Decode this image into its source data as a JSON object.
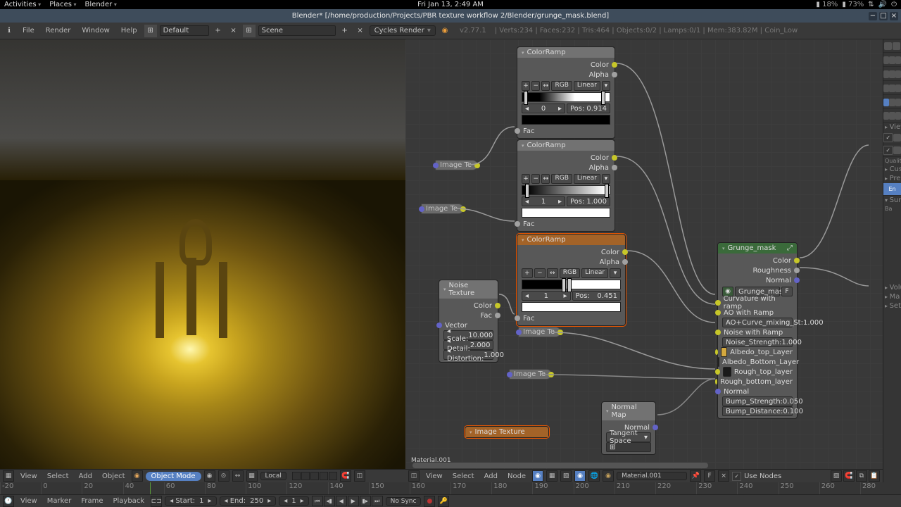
{
  "os_topbar": {
    "activities": "Activities",
    "places": "Places",
    "blender": "Blender",
    "datetime": "Fri Jan 13,  2:49 AM",
    "cpu_pct": "18%",
    "ram_pct": "73%"
  },
  "window_title": "Blender* [/home/production/Projects/PBR texture workflow 2/Blender/grunge_mask.blend]",
  "top_menu": {
    "file": "File",
    "render": "Render",
    "window": "Window",
    "help": "Help",
    "layout": "Default",
    "scene": "Scene",
    "engine": "Cycles Render",
    "version": "v2.77.1",
    "stats": "Verts:234 | Faces:232 | Tris:464 | Objects:0/2 | Lamps:0/1 | Mem:383.82M | Coin_Low"
  },
  "viewport": {
    "menus": {
      "view": "View",
      "select": "Select",
      "add": "Add",
      "object": "Object"
    },
    "mode": "Object Mode",
    "orientation": "Local"
  },
  "node_editor": {
    "menus": {
      "view": "View",
      "select": "Select",
      "add": "Add",
      "node": "Node"
    },
    "material_name": "Material.001",
    "use_nodes_label": "Use Nodes",
    "material_label": "Material.001"
  },
  "nodes": {
    "imgtex_1": "Image Te",
    "imgtex_2": "Image Te",
    "imgtex_3": "Image Te",
    "imgtex_4": "Image Te",
    "noise": {
      "title": "Noise Texture",
      "out_color": "Color",
      "out_fac": "Fac",
      "in_vector": "Vector",
      "scale_l": "Scale:",
      "scale_v": "10.000",
      "detail_l": "Detail:",
      "detail_v": "2.000",
      "distort_l": "Distortion:",
      "distort_v": "1.000"
    },
    "ramp": {
      "title": "ColorRamp",
      "out_color": "Color",
      "out_alpha": "Alpha",
      "in_fac": "Fac",
      "mode": "RGB",
      "interp": "Linear",
      "pos_l": "Pos:"
    },
    "ramp1": {
      "index": "0",
      "pos": "0.914"
    },
    "ramp2": {
      "index": "1",
      "pos": "1.000"
    },
    "ramp3": {
      "index": "1",
      "pos": "0.451"
    },
    "normal_map": {
      "title": "Normal Map",
      "out": "Normal",
      "space": "Tangent Space"
    },
    "image_texture_bottom": {
      "title": "Image Texture"
    },
    "grunge": {
      "title": "Grunge_mask",
      "out_color": "Color",
      "out_roughness": "Roughness",
      "out_normal": "Normal",
      "group_name": "Grunge_mask",
      "f_label": "F",
      "curv": "Curvature with ramp",
      "ao": "AO with Ramp",
      "ao_curve_l": "AO+Curve_mixing_St:",
      "ao_curve_v": "1.000",
      "noise_ramp": "Noise with Ramp",
      "noise_strength_l": "Noise_Strength:",
      "noise_strength_v": "1.000",
      "albedo_top": "Albedo_top_Layer",
      "albedo_bot": "Albedo_Bottom_Layer",
      "rough_top": "Rough_top_layer",
      "rough_bot": "Rough_bottom_layer",
      "normal": "Normal",
      "bump_strength_l": "Bump_Strength:",
      "bump_strength_v": "0.050",
      "bump_distance_l": "Bump_Distance:",
      "bump_distance_v": "0.100"
    }
  },
  "right_panel": {
    "view": "View",
    "quality": "Quality",
    "cust": "Cust",
    "prev": "Prev",
    "en": "En",
    "surf": "Surf",
    "ba": "Ba",
    "volu": "Volu",
    "sett": "Sett",
    "ma": "Ma"
  },
  "timeline": {
    "ticks": [
      "-20",
      "0",
      "20",
      "40",
      "60",
      "80",
      "100",
      "120",
      "140",
      "150",
      "160",
      "170",
      "180",
      "190",
      "200",
      "210",
      "220",
      "230",
      "240",
      "250",
      "260",
      "280"
    ],
    "view": "View",
    "marker": "Marker",
    "frame": "Frame",
    "playback": "Playback",
    "start_l": "Start:",
    "start_v": "1",
    "end_l": "End:",
    "end_v": "250",
    "current": "1",
    "sync": "No Sync"
  }
}
